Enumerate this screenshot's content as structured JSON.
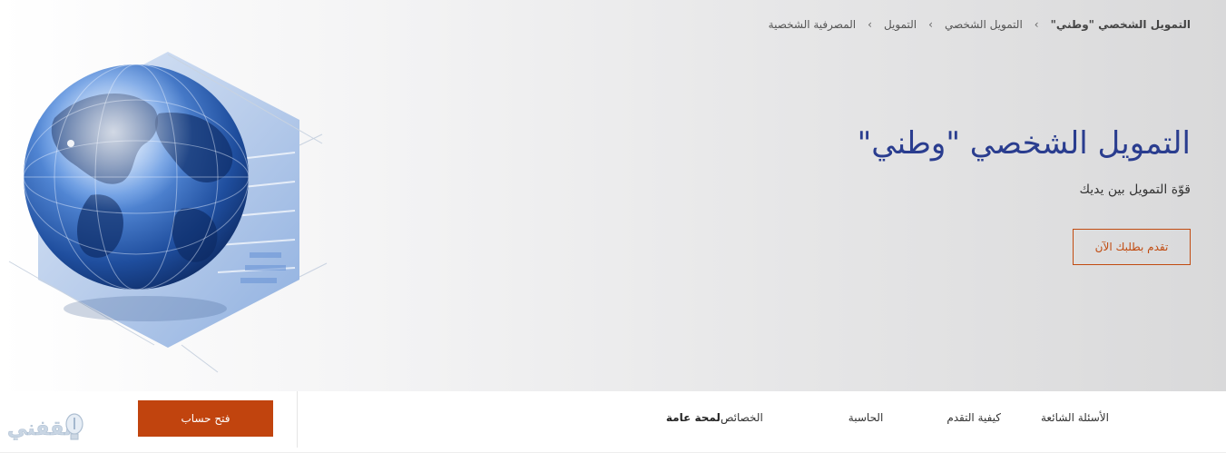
{
  "breadcrumb": {
    "items": [
      "المصرفية الشخصية",
      "التمويل",
      "التمويل الشخصي",
      "التمويل الشخصي \"وطني\""
    ],
    "separator": "›"
  },
  "hero": {
    "title": "التمويل الشخصي \"وطني\"",
    "subtitle": "قوّة التمويل بين يديك",
    "apply_label": "تقدم بطلبك الآن"
  },
  "subnav": {
    "tabs": [
      {
        "label": "لمحة عامة",
        "active": true
      },
      {
        "label": "الخصائص",
        "active": false
      },
      {
        "label": "الحاسبة",
        "active": false
      },
      {
        "label": "كيفية التقدم",
        "active": false
      },
      {
        "label": "الأسئلة الشائعة",
        "active": false
      }
    ],
    "open_account_label": "فتح حساب"
  },
  "watermark": {
    "text": "ثقفني",
    "icon": "lightbulb-icon"
  },
  "colors": {
    "title": "#2a3d8f",
    "accent": "#c1440e",
    "button_outline": "#c14b10"
  }
}
